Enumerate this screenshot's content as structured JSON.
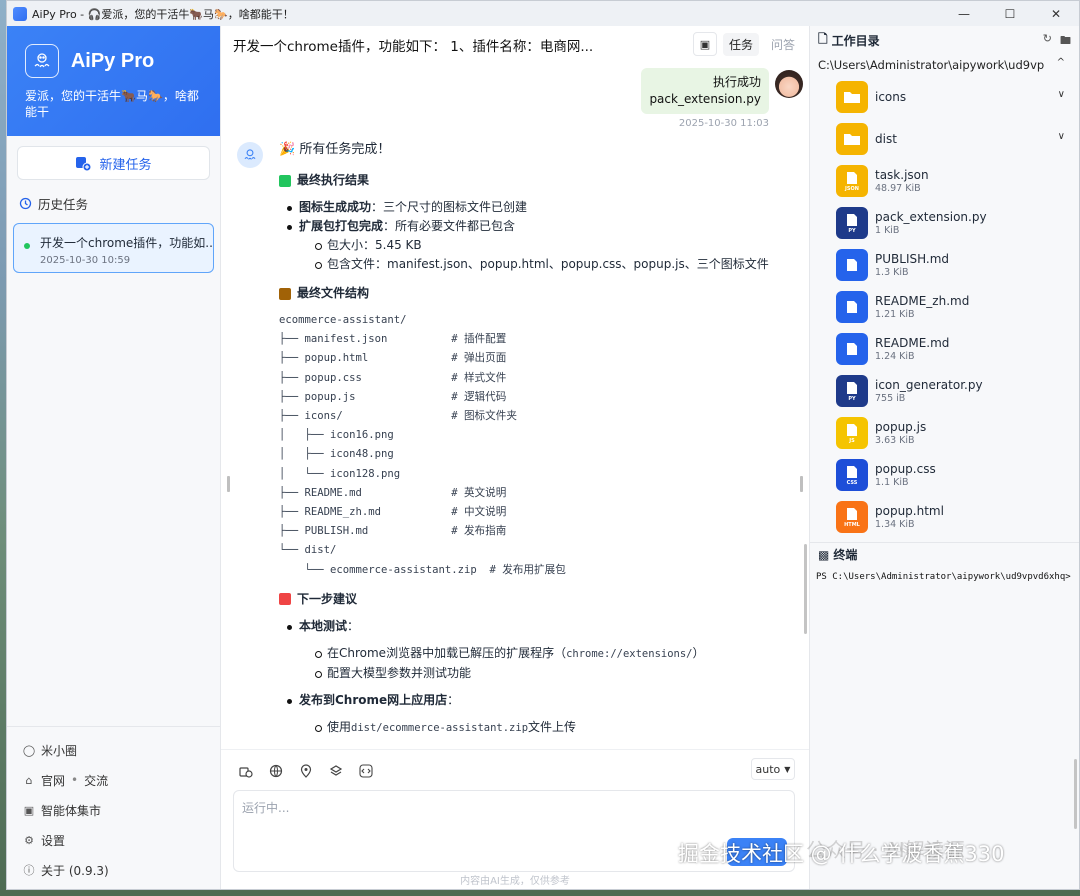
{
  "window": {
    "title": "AiPy Pro - 🎧爱派，您的干活牛🐂马🐎，啥都能干！",
    "minimize": "—",
    "maximize": "☐",
    "close": "✕"
  },
  "sidebar": {
    "brand_name": "AiPy Pro",
    "slogan": "爱派，您的干活牛🐂马🐎，啥都能干",
    "new_task": "新建任务",
    "history_title": "历史任务",
    "history_items": [
      {
        "title": "开发一个chrome插件，功能如...",
        "date": "2025-10-30 10:59"
      }
    ],
    "footer": {
      "mixiaoquan": "米小圈",
      "website": "官网",
      "sep": "•",
      "community": "交流",
      "agent_market": "智能体集市",
      "settings": "设置",
      "about": "关于  (0.9.3)"
    }
  },
  "chat": {
    "title": "开发一个chrome插件，功能如下： 1、插件名称：电商网...",
    "tab_task": "任务",
    "tab_qa": "问答",
    "user_message": {
      "line1": "执行成功",
      "line2": "pack_extension.py",
      "time": "2025-10-30 11:03"
    },
    "bot": {
      "all_done": "🎉 所有任务完成！",
      "final_result_title": "最终执行结果",
      "icon_gen_label": "图标生成成功",
      "icon_gen_text": "：三个尺寸的图标文件已创建",
      "pack_label": "扩展包打包完成",
      "pack_text": "：所有必要文件都已包含",
      "pack_size": "包大小：5.45 KB",
      "pack_files": "包含文件：manifest.json、popup.html、popup.css、popup.js、三个图标文件",
      "structure_title": "最终文件结构",
      "tree": "ecommerce-assistant/\n├── manifest.json          # 插件配置\n├── popup.html             # 弹出页面\n├── popup.css              # 样式文件\n├── popup.js               # 逻辑代码\n├── icons/                 # 图标文件夹\n│   ├── icon16.png\n│   ├── icon48.png\n│   └── icon128.png\n├── README.md              # 英文说明\n├── README_zh.md           # 中文说明\n├── PUBLISH.md             # 发布指南\n└── dist/\n    └── ecommerce-assistant.zip  # 发布用扩展包",
      "next_title": "下一步建议",
      "local_test": "本地测试",
      "colon": "：",
      "load_ext_pre": "在Chrome浏览器中加载已解压的扩展程序（",
      "load_ext_code": "chrome://extensions/",
      "load_ext_post": "）",
      "config_model": "配置大模型参数并测试功能",
      "publish_store": "发布到Chrome网上应用店",
      "use_pre": "使用",
      "use_code": "dist/ecommerce-assistant.zip",
      "use_post": "文件上传"
    },
    "input": {
      "mode": "auto",
      "placeholder": "运行中...",
      "disclaimer": "内容由AI生成，仅供参考"
    }
  },
  "workspace": {
    "title": "工作目录",
    "path": "C:\\Users\\Administrator\\aipywork\\ud9vp",
    "files": [
      {
        "name": "icons",
        "type": "folder",
        "color": "#f5b400",
        "label": ""
      },
      {
        "name": "dist",
        "type": "folder",
        "color": "#f5b400",
        "label": ""
      },
      {
        "name": "task.json",
        "size": "48.97 KiB",
        "type": "file",
        "color": "#f5b400",
        "label": "JSON"
      },
      {
        "name": "pack_extension.py",
        "size": "1 KiB",
        "type": "file",
        "color": "#1e3a8a",
        "label": "PY"
      },
      {
        "name": "PUBLISH.md",
        "size": "1.3 KiB",
        "type": "file",
        "color": "#2563eb",
        "label": ""
      },
      {
        "name": "README_zh.md",
        "size": "1.21 KiB",
        "type": "file",
        "color": "#2563eb",
        "label": ""
      },
      {
        "name": "README.md",
        "size": "1.24 KiB",
        "type": "file",
        "color": "#2563eb",
        "label": ""
      },
      {
        "name": "icon_generator.py",
        "size": "755 iB",
        "type": "file",
        "color": "#1e3a8a",
        "label": "PY"
      },
      {
        "name": "popup.js",
        "size": "3.63 KiB",
        "type": "file",
        "color": "#f5c400",
        "label": "JS"
      },
      {
        "name": "popup.css",
        "size": "1.1 KiB",
        "type": "file",
        "color": "#1d4ed8",
        "label": "CSS"
      },
      {
        "name": "popup.html",
        "size": "1.34 KiB",
        "type": "file",
        "color": "#f97316",
        "label": "HTML"
      }
    ],
    "terminal_title": "终端",
    "terminal_line": "PS C:\\Users\\Administrator\\aipywork\\ud9vpvd6xhq>"
  },
  "watermark": "掘金技术社区 @ 什么学波香蕉330",
  "watermark_faint": "公众号 · AI解读源"
}
